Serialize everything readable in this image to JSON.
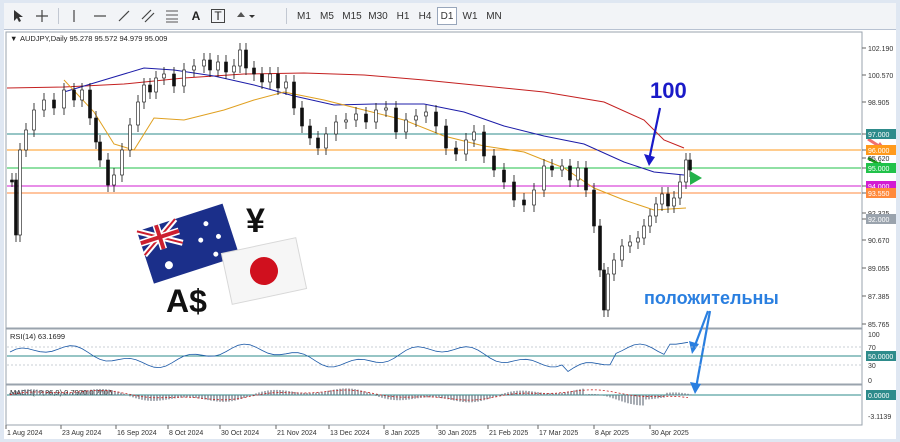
{
  "toolbar": {
    "tools": [
      {
        "icon": "cursor-arrow-icon"
      },
      {
        "icon": "crosshair-icon"
      },
      {
        "icon": "vertical-line-icon"
      },
      {
        "icon": "horizontal-line-icon"
      },
      {
        "icon": "trendline-icon"
      },
      {
        "icon": "equidistant-channel-icon"
      },
      {
        "icon": "fibonacci-icon"
      },
      {
        "icon": "text-tool-icon",
        "glyph": "A"
      },
      {
        "icon": "text-label-icon",
        "glyph": "T"
      },
      {
        "icon": "shapes-dropdown-icon"
      }
    ],
    "timeframes": [
      "M1",
      "M5",
      "M15",
      "M30",
      "H1",
      "H4",
      "D1",
      "W1",
      "MN"
    ],
    "active_timeframe": "D1"
  },
  "chart": {
    "header": "AUDJPY,Daily  95.278 95.572 94.979 95.009",
    "symbol_arrow": "▼",
    "price_labels": [
      "102.190",
      "100.570",
      "98.905",
      "97.000",
      "96.000",
      "95.620",
      "95.000",
      "94.000",
      "93.550",
      "92.325",
      "92.000",
      "90.670",
      "89.055",
      "87.385",
      "85.765"
    ],
    "highlighted_levels": [
      {
        "label": "97.000",
        "color": "#2e8b8b",
        "text_color": "#ffffff"
      },
      {
        "label": "96.000",
        "color": "#ff9a1c",
        "text_color": "#ffffff"
      },
      {
        "label": "95.000",
        "color": "#21c24a",
        "text_color": "#ffffff"
      },
      {
        "label": "94.000",
        "color": "#d21cd2",
        "text_color": "#ffffff"
      },
      {
        "label": "93.550",
        "color": "#ff8a3c",
        "text_color": "#ffffff"
      },
      {
        "label": "92.000",
        "color": "#9aa3ad",
        "text_color": "#ffffff"
      }
    ],
    "date_labels": [
      "1 Aug 2024",
      "23 Aug 2024",
      "16 Sep 2024",
      "8 Oct 2024",
      "30 Oct 2024",
      "21 Nov 2024",
      "13 Dec 2024",
      "8 Jan 2025",
      "30 Jan 2025",
      "21 Feb 2025",
      "17 Mar 2025",
      "8 Apr 2025",
      "30 Apr 2025"
    ],
    "annotation_number": "100",
    "annotation_text": "положительны",
    "image_symbols": {
      "yen": "¥",
      "aud": "A$"
    },
    "colors": {
      "bull": "#2a8a2a",
      "ma_blue": "#1c1ca8",
      "ma_red": "#c42020",
      "ma_orange": "#e0a020",
      "candles": "#101010",
      "annotation_blue": "#1a1ac8",
      "arrow_blue": "#2a7fe0",
      "arrow_red": "#f07070",
      "arrow_green": "#1aa01a"
    }
  },
  "rsi": {
    "label": "RSI(14) 63.1699",
    "levels": [
      "100",
      "70",
      "50.0000",
      "30",
      "0"
    ],
    "highlight": {
      "label": "50.0000",
      "color": "#2e8b8b"
    }
  },
  "macd": {
    "label": "MACD(12,26,9) 0.7970 0.2606",
    "levels": [
      "0.0000",
      "-3.1139"
    ],
    "highlight": {
      "label": "0.0000",
      "color": "#2e8b8b"
    }
  }
}
